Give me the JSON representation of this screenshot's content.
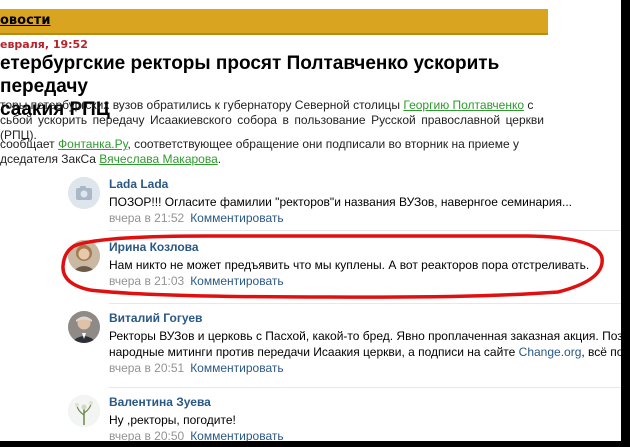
{
  "section": {
    "label": "овости"
  },
  "article": {
    "date": "евраля, 19:52",
    "title_line1": "етербургские ректоры просят Полтавченко ускорить передачу",
    "title_line2": "саакия  РПЦ",
    "p1_a": "торы петербургских вузов обратились к губернатору Северной столицы ",
    "p1_link": "Георгию Полтавченко",
    "p1_b": " с",
    "p1_c": "сьбой ускорить передачу Исаакиевского собора в пользование Русской православной церкви (РПЦ).",
    "p2_a": " сообщает ",
    "p2_link1": "Фонтанка.Ру",
    "p2_b": ", соответствующее обращение они подписали во вторник на приеме у",
    "p2_c": "дседателя ЗакСа ",
    "p2_link2": "Вячеслава Макарова",
    "p2_d": "."
  },
  "comments": [
    {
      "author": "Lada Lada",
      "text": "ПОЗОР!!! Огласите фамилии \"ректоров\"и названия ВУЗов, навернгое семинария...",
      "time": "вчера в 21:52",
      "reply": "Комментировать",
      "avatar_icon": "camera-icon"
    },
    {
      "author": "Ирина Козлова",
      "text": "Нам никто не может предъявить что мы куплены. А вот реакторов пора отстреливать.",
      "time": "вчера в 21:03",
      "reply": "Комментировать",
      "avatar_icon": "user-photo"
    },
    {
      "author": "Виталий Гогуев",
      "text1": "Ректоры ВУЗов и церковь с Пасхой, какой-то бред. Явно проплаченная заказная акция. Позор! А",
      "text2_a": "народные митинги против передачи Исаакия церкви, а подписи на сайте ",
      "text2_link": "Change.org",
      "text2_b": ", всё побоку",
      "time": "вчера в 20:51",
      "reply": "Комментировать",
      "avatar_icon": "user-photo"
    },
    {
      "author": "Валентина Зуева",
      "text": "Ну ,ректоры, погодите!",
      "time": "вчера в 20:50",
      "reply": "Комментировать",
      "avatar_icon": "flower-photo"
    }
  ],
  "colors": {
    "section_bar": "#d9a520",
    "date": "#b8232b",
    "article_link": "#2e9a2e",
    "author": "#2a5885",
    "meta": "#939393",
    "highlight": "#e01010"
  }
}
